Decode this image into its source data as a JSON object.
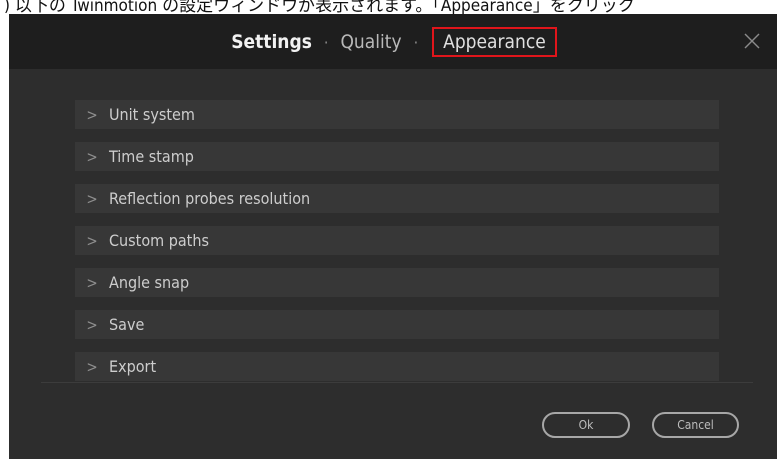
{
  "caption": ") 以下の Twinmotion の設定ウィンドウが表示されます。「Appearance」をクリック",
  "header": {
    "tabs": [
      {
        "label": "Settings"
      },
      {
        "label": "Quality"
      },
      {
        "label": "Appearance"
      }
    ],
    "separator": "·",
    "highlight_color": "#e0151b"
  },
  "sections": [
    {
      "label": "Unit system"
    },
    {
      "label": "Time stamp"
    },
    {
      "label": "Reflection probes resolution"
    },
    {
      "label": "Custom paths"
    },
    {
      "label": "Angle snap"
    },
    {
      "label": "Save"
    },
    {
      "label": "Export"
    }
  ],
  "chevron": ">",
  "buttons": {
    "ok": "Ok",
    "cancel": "Cancel"
  },
  "icons": {
    "close": "close-icon",
    "expand": "chevron-right-icon"
  }
}
